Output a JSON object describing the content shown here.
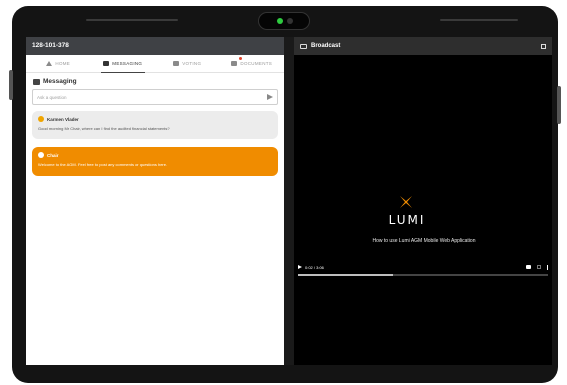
{
  "meeting": {
    "id": "128-101-378"
  },
  "tabs": [
    {
      "label": "HOME",
      "icon": "home-icon"
    },
    {
      "label": "MESSAGING",
      "icon": "chat-icon"
    },
    {
      "label": "VOTING",
      "icon": "ballot-icon"
    },
    {
      "label": "DOCUMENTS",
      "icon": "document-icon"
    }
  ],
  "active_tab": "MESSAGING",
  "messaging": {
    "title": "Messaging",
    "ask_placeholder": "Ask a question",
    "messages": [
      {
        "author": "Karmen Vlader",
        "text": "Good morning Mr Chair, where can I find the audited financial statements?",
        "style": "user",
        "avatar_color": "#f0a500"
      },
      {
        "author": "Chair",
        "text": "Welcome to the AGM. Feel free to post any comments or questions here.",
        "style": "chair",
        "avatar_color": "#ffffff"
      }
    ]
  },
  "broadcast": {
    "title": "Broadcast",
    "logo_text": "LUMI",
    "video_title": "How to use Lumi AGM Mobile Web Application",
    "time": "0:02 / 3:06",
    "progress": 0.38
  },
  "colors": {
    "accent": "#f08c00",
    "meeting_bar": "#3f4145",
    "broadcast_bar": "#2e2e2e"
  }
}
